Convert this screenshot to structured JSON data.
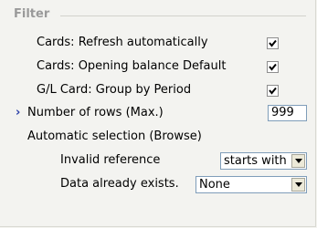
{
  "group": {
    "title": "Filter"
  },
  "settings": [
    {
      "label": "Cards: Refresh automatically",
      "checked": true
    },
    {
      "label": "Cards: Opening balance Default",
      "checked": true
    },
    {
      "label": "G/L Card: Group by Period",
      "checked": true
    }
  ],
  "rows_max": {
    "label": "Number of rows (Max.)",
    "value": "999",
    "marker": "›"
  },
  "auto_selection": {
    "label": "Automatic selection (Browse)",
    "invalid_reference": {
      "label": "Invalid reference",
      "value": "starts with"
    },
    "data_exists": {
      "label": "Data already exists.",
      "value": "None"
    }
  }
}
